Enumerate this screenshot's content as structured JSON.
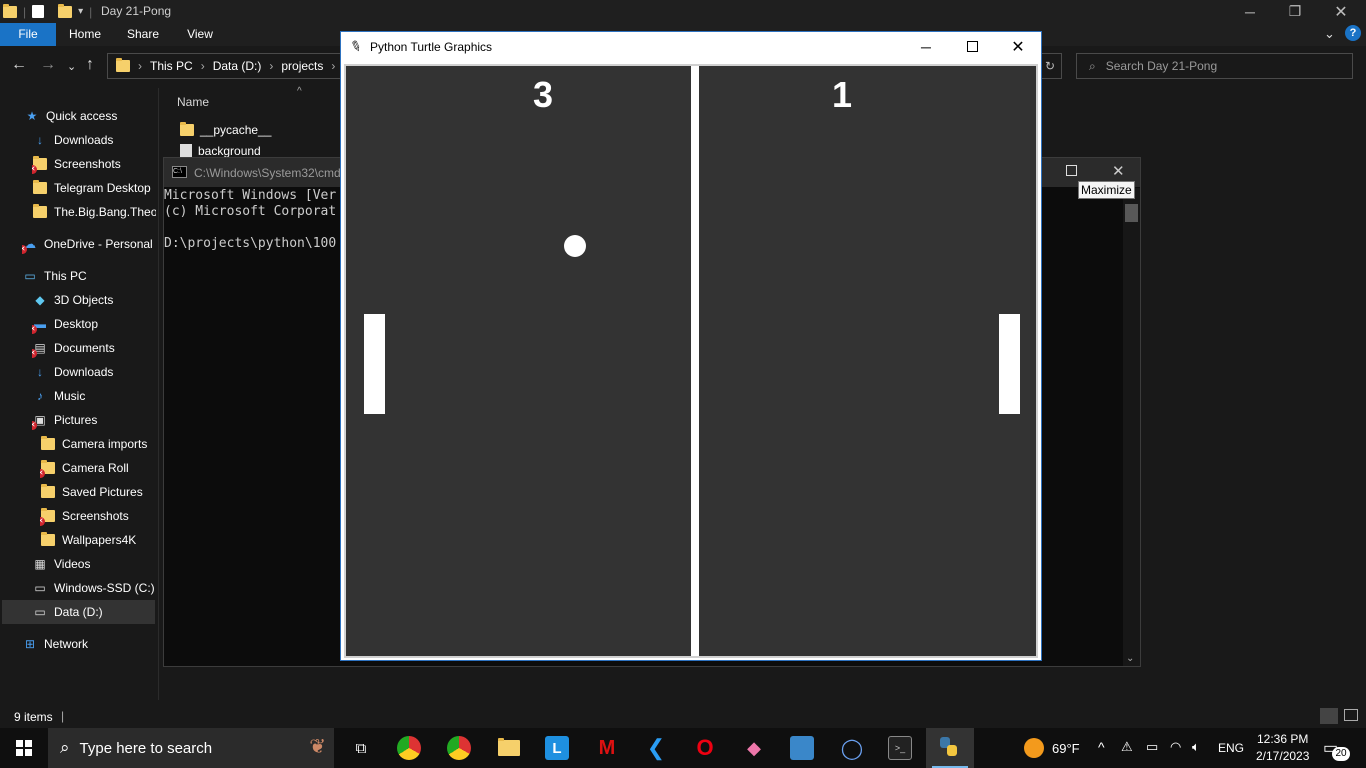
{
  "explorer": {
    "title": "Day 21-Pong",
    "ribbon": {
      "file": "File",
      "home": "Home",
      "share": "Share",
      "view": "View"
    },
    "address": [
      "This PC",
      "Data (D:)",
      "projects"
    ],
    "search_placeholder": "Search Day 21-Pong",
    "nav": {
      "quick_access": "Quick access",
      "downloads": "Downloads",
      "screenshots": "Screenshots",
      "telegram": "Telegram Desktop",
      "bigbang": "The.Big.Bang.Theor",
      "onedrive": "OneDrive - Personal",
      "this_pc": "This PC",
      "objects3d": "3D Objects",
      "desktop": "Desktop",
      "documents": "Documents",
      "downloads2": "Downloads",
      "music": "Music",
      "pictures": "Pictures",
      "camera_imports": "Camera imports",
      "camera_roll": "Camera Roll",
      "saved_pictures": "Saved Pictures",
      "screenshots2": "Screenshots",
      "wallpapers": "Wallpapers4K",
      "videos": "Videos",
      "windows_ssd": "Windows-SSD (C:)",
      "data_d": "Data (D:)",
      "network": "Network"
    },
    "column_name": "Name",
    "files": [
      "__pycache__",
      "background"
    ],
    "status": "9 items"
  },
  "cmd": {
    "title": "C:\\Windows\\System32\\cmd",
    "line1": "Microsoft Windows [Ver",
    "line2": "(c) Microsoft Corporat",
    "line3": "D:\\projects\\python\\100",
    "tooltip": "Maximize"
  },
  "turtle": {
    "title": "Python Turtle Graphics",
    "score_left": "3",
    "score_right": "1"
  },
  "taskbar": {
    "search_placeholder": "Type here to search",
    "weather": "69°F",
    "lang": "ENG",
    "time": "12:36 PM",
    "date": "2/17/2023",
    "notifications": "20"
  },
  "colors": {
    "accent": "#1a73c6",
    "canvas_bg": "#333333",
    "error_badge": "#d0262f"
  }
}
